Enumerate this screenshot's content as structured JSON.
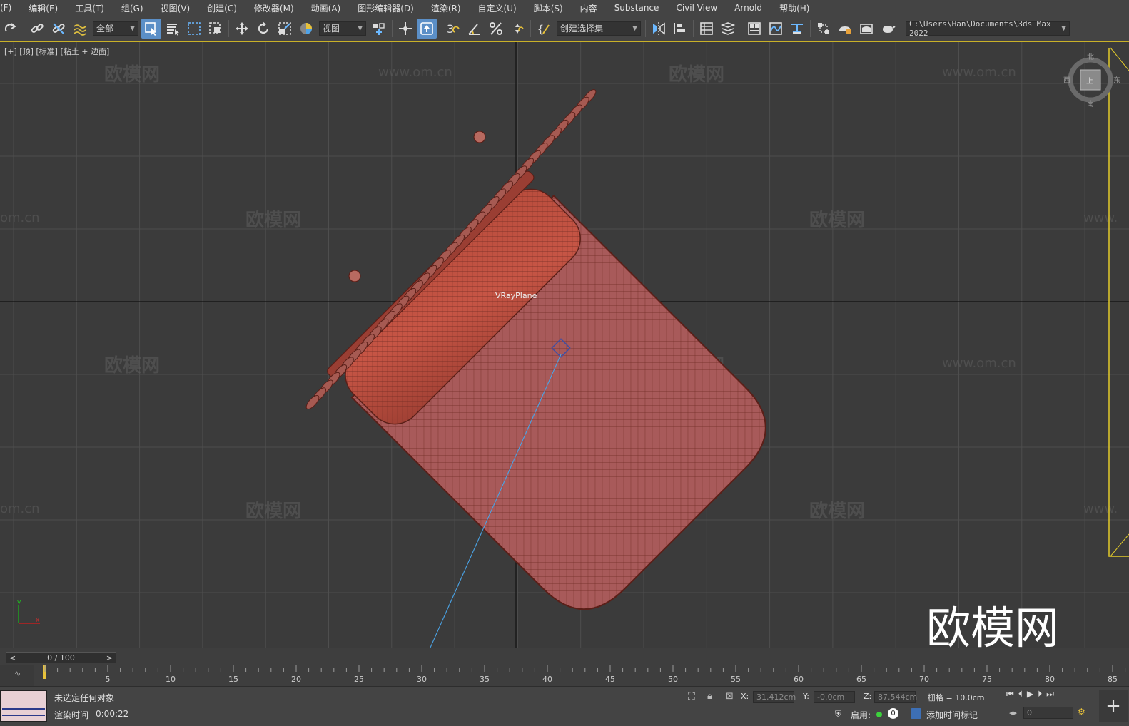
{
  "menu": [
    "(F)",
    "编辑(E)",
    "工具(T)",
    "组(G)",
    "视图(V)",
    "创建(C)",
    "修改器(M)",
    "动画(A)",
    "图形编辑器(D)",
    "渲染(R)",
    "自定义(U)",
    "脚本(S)",
    "内容",
    "Substance",
    "Civil View",
    "Arnold",
    "帮助(H)"
  ],
  "toolbar": {
    "filter_value": "全部",
    "ref_coord_value": "视图",
    "snap_count": "3",
    "selection_set_placeholder": "创建选择集",
    "project_path": "C:\\Users\\Han\\Documents\\3ds Max 2022"
  },
  "viewport": {
    "label": "[+] [顶] [标准] [粘土 + 边面]",
    "object_label": "VRayPlane",
    "viewcube": {
      "n": "北",
      "s": "南",
      "w": "西",
      "e": "东",
      "face": "上"
    },
    "watermark_cn": "欧模网",
    "watermark_url": "www.om.cn",
    "watermark_url_partial": "om.cn",
    "watermark_url_partial2": "www.",
    "logo_text": "欧模网",
    "model_color": "#a85a5a",
    "wire_color": "#6e2a22"
  },
  "timeline": {
    "frame_display": "0 / 100",
    "ticks": [
      5,
      10,
      15,
      20,
      25,
      30,
      35,
      40,
      45,
      50,
      55,
      60,
      65,
      70,
      75,
      80,
      85
    ],
    "total_frames": 100
  },
  "status": {
    "selection_msg": "未选定任何对象",
    "render_time_label": "渲染时间",
    "render_time_value": "0:00:22",
    "x_label": "X:",
    "x_value": "31.412cm",
    "y_label": "Y:",
    "y_value": "-0.0cm",
    "z_label": "Z:",
    "z_value": "87.544cm",
    "grid_label": "栅格 = 10.0cm",
    "enable_label": "启用:",
    "enable_count": "0",
    "add_time_tag": "添加时间标记",
    "frame_input": "0"
  }
}
